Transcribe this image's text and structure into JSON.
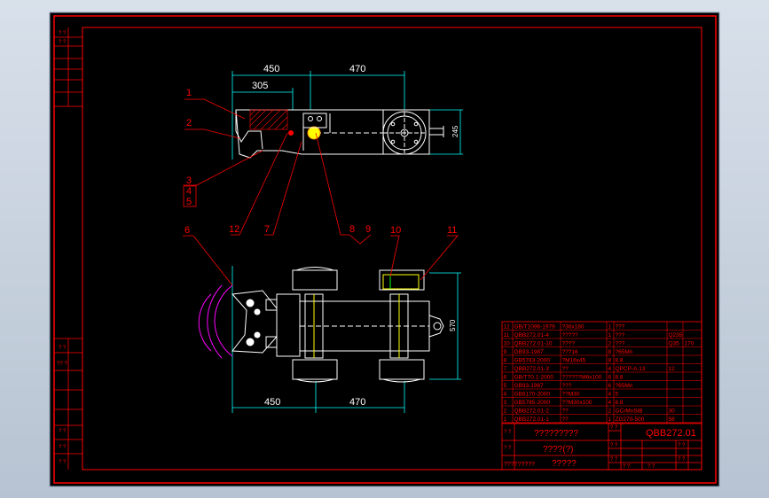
{
  "colors": {
    "background": "#000000",
    "viewport": "#c5cfdb",
    "frame": "#ff0000",
    "line": "#ffffff",
    "dimension": "#00ffff",
    "label": "#ff0000",
    "dim_text": "#ffffff",
    "hatch": "#ff0000",
    "yellow": "#ffff00",
    "magenta": "#ff00ff",
    "green": "#00ff00"
  },
  "dimensions": {
    "top_left": "450",
    "top_right": "470",
    "top_inner": "305",
    "top_height": "245",
    "bottom_left": "450",
    "bottom_right": "470",
    "bottom_height": "570"
  },
  "leaders": {
    "l1": "1",
    "l2": "2",
    "l3": "3",
    "l4": "4",
    "l5": "5",
    "l6": "6",
    "l7": "7",
    "l8": "8",
    "l9": "9",
    "l10": "10",
    "l11": "11",
    "l12": "12"
  },
  "left_strip": {
    "top": [
      "? ?",
      "? ?"
    ],
    "bottom": [
      "? ?",
      "?? ?",
      "? ?",
      "? ?",
      "? ?"
    ]
  },
  "bom_rows": [
    [
      "12",
      "GB/T1096-1979",
      "?36x180",
      "1",
      "???",
      "",
      ""
    ],
    [
      "11",
      "QBB272.01-4",
      "?????",
      "1",
      "???",
      "Q235",
      ""
    ],
    [
      "10",
      "QBB272.01-10",
      "????",
      "2",
      "???",
      "Q35",
      "170"
    ],
    [
      "9",
      "GB93-1987",
      "???16",
      "8",
      "?65Mn",
      "",
      ""
    ],
    [
      "8",
      "GB5783-2000",
      "?M16x45",
      "8",
      "8.8",
      "",
      ""
    ],
    [
      "7",
      "QBB272.01-3",
      "??",
      "4",
      "QPCP-A.13",
      "12",
      ""
    ],
    [
      "6",
      "GB/T70.1-2000",
      "??????M6x100",
      "6",
      "8.8",
      "",
      ""
    ],
    [
      "5",
      "GB93-1987",
      "???",
      "6",
      "?65Mn",
      "",
      ""
    ],
    [
      "4",
      "GB6170-2000",
      "??M30",
      "4",
      "5",
      "",
      ""
    ],
    [
      "3",
      "GB5785-2000",
      "??M30x100",
      "4",
      "8.8",
      "",
      ""
    ],
    [
      "2",
      "QBB272.01-2",
      "??",
      "2",
      "GCrMnSiB",
      "30",
      ""
    ],
    [
      "1",
      "QBB272.01-1",
      "??",
      "1",
      "ZG270-500",
      "58",
      ""
    ]
  ],
  "title_block": {
    "title": "?????????",
    "subtitle": "????(?)",
    "drawing_no": "QBB272.01",
    "company": "?????",
    "cell_a": "? ?",
    "cell_b": "? ?",
    "cell_c": "? ?",
    "cell_d": "? ?",
    "cell_e": "? ?",
    "scale_label": "? ?",
    "sheet_label": "? ?",
    "footer_left": "?????????",
    "footer_mid": "? ?",
    "footer_right": "? ?"
  }
}
